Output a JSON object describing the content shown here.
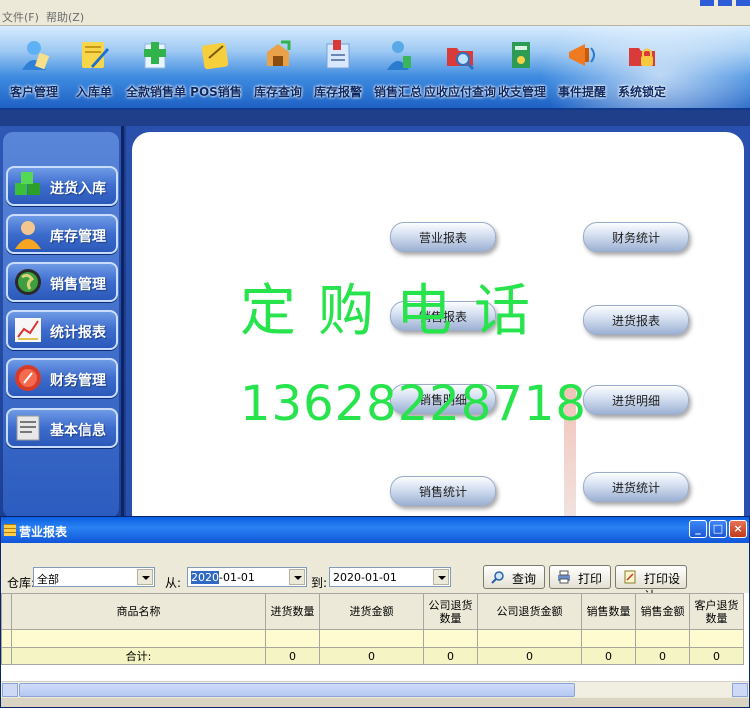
{
  "menu": {
    "file": "文件(F)",
    "help": "帮助(Z)"
  },
  "toolbar": [
    {
      "label": "客户管理",
      "icon": "customer-icon"
    },
    {
      "label": "入库单",
      "icon": "stock-in-icon"
    },
    {
      "label": "全款销售单",
      "icon": "full-sales-icon"
    },
    {
      "label": "POS销售",
      "icon": "pos-icon"
    },
    {
      "label": "库存查询",
      "icon": "inventory-query-icon"
    },
    {
      "label": "库存报警",
      "icon": "inventory-alarm-icon"
    },
    {
      "label": "销售汇总",
      "icon": "sales-summary-icon"
    },
    {
      "label": "应收应付查询",
      "icon": "ar-ap-icon"
    },
    {
      "label": "收支管理",
      "icon": "finance-icon"
    },
    {
      "label": "事件提醒",
      "icon": "reminder-icon"
    },
    {
      "label": "系统锁定",
      "icon": "lock-icon"
    }
  ],
  "sidebar": [
    {
      "label": "进货入库",
      "icon": "cubes-icon"
    },
    {
      "label": "库存管理",
      "icon": "person-icon"
    },
    {
      "label": "销售管理",
      "icon": "globe-icon"
    },
    {
      "label": "统计报表",
      "icon": "chart-icon"
    },
    {
      "label": "财务管理",
      "icon": "coin-icon"
    },
    {
      "label": "基本信息",
      "icon": "notebook-icon"
    }
  ],
  "report_buttons": {
    "business_report": "营业报表",
    "sales_report": "销售报表",
    "sales_detail": "销售明细",
    "sales_stats": "销售统计",
    "finance_stats": "财务统计",
    "purchase_report": "进货报表",
    "purchase_detail": "进货明细",
    "purchase_stats": "进货统计"
  },
  "overlay": {
    "line1": "定购电话",
    "line2": "13628228718"
  },
  "dialog": {
    "title": "营业报表",
    "warehouse_label": "仓库:",
    "warehouse_value": "全部",
    "from_label": "从:",
    "from_date_selected": "2020",
    "from_date_rest": "-01-01",
    "to_label": "到:",
    "to_date": "2020-01-01",
    "btn_query": "查询",
    "btn_print": "打印",
    "btn_print_design": "打印设计",
    "win_min": "_",
    "win_max": "□",
    "win_close": "×"
  },
  "grid": {
    "columns": [
      "商品名称",
      "进货数量",
      "进货金额",
      "公司退货数量",
      "公司退货金额",
      "销售数量",
      "销售金额",
      "客户退货数量"
    ],
    "total_label": "合计:",
    "totals": [
      "0",
      "0",
      "0",
      "0",
      "0",
      "0",
      "0"
    ]
  },
  "colors": {
    "accent": "#2950ad",
    "overlay_green": "#27e34c",
    "title_blue": "#0a5fe0"
  }
}
